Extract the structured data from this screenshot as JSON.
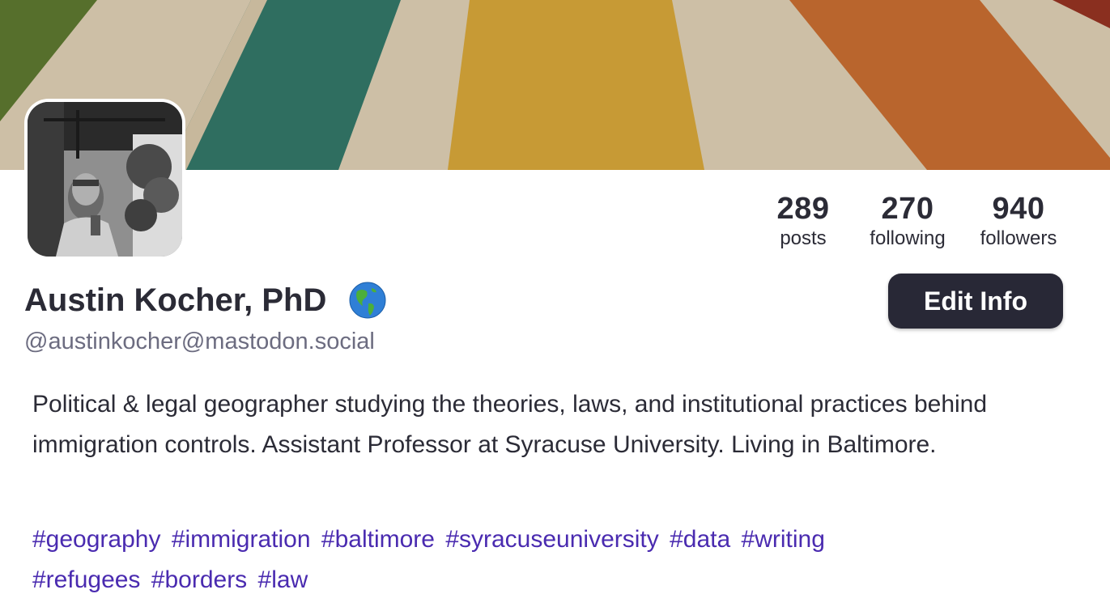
{
  "profile": {
    "display_name": "Austin Kocher, PhD",
    "display_name_emoji": "globe-americas-icon",
    "handle": "@austinkocher@mastodon.social",
    "bio": "Political & legal geographer studying the theories, laws, and institutional practices behind immigration controls. Assistant Professor at Syracuse University. Living in Baltimore.",
    "hashtags": [
      "#geography",
      "#immigration",
      "#baltimore",
      "#syracuseuniversity",
      "#data",
      "#writing",
      "#refugees",
      "#borders",
      "#law"
    ]
  },
  "stats": {
    "posts": {
      "value": "289",
      "label": "posts"
    },
    "following": {
      "value": "270",
      "label": "following"
    },
    "followers": {
      "value": "940",
      "label": "followers"
    }
  },
  "actions": {
    "edit_label": "Edit Info"
  },
  "colors": {
    "text": "#2b2b36",
    "handle": "#6c6c80",
    "hashtag": "#4a2bb0",
    "button_bg": "#282836",
    "banner_stripes": [
      "#4f6a2c",
      "#cdbfa6",
      "#2f6f5f",
      "#d8b25a",
      "#c58a2e",
      "#b55a2a",
      "#8a2a1e"
    ]
  }
}
